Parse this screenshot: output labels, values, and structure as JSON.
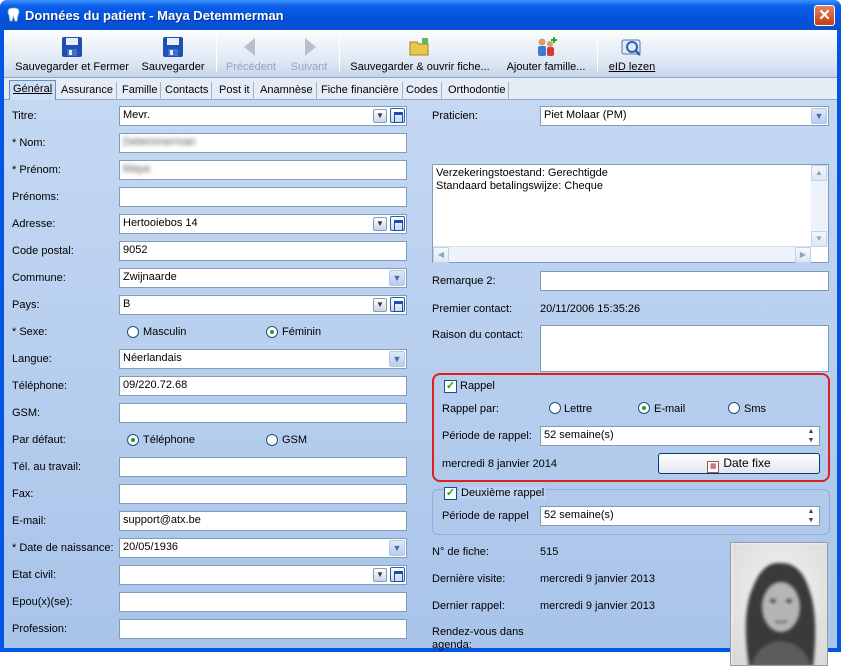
{
  "window": {
    "title": "Données du patient - Maya Detemmerman",
    "close": "✕"
  },
  "toolbar": {
    "save_close": "Sauvegarder et Fermer",
    "save": "Sauvegarder",
    "prev": "Précédent",
    "next": "Suivant",
    "save_open": "Sauvegarder & ouvrir fiche...",
    "add_family": "Ajouter famille...",
    "eid": "eID lezen"
  },
  "tabs": [
    "Général",
    "Assurance",
    "Famille",
    "Contacts",
    "Post it",
    "Anamnèse",
    "Fiche financière",
    "Codes",
    "Orthodontie"
  ],
  "left": {
    "titre": {
      "label": "Titre:",
      "value": "Mevr."
    },
    "nom": {
      "label": "* Nom:",
      "value": "Detemmerman"
    },
    "prenom": {
      "label": "* Prénom:",
      "value": "Maya"
    },
    "prenoms": {
      "label": "Prénoms:",
      "value": ""
    },
    "adresse": {
      "label": "Adresse:",
      "value": "Hertooiebos 14"
    },
    "code_postal": {
      "label": "Code postal:",
      "value": "9052"
    },
    "commune": {
      "label": "Commune:",
      "value": "Zwijnaarde"
    },
    "pays": {
      "label": "Pays:",
      "value": "B"
    },
    "sexe": {
      "label": "* Sexe:",
      "opt1": "Masculin",
      "opt2": "Féminin",
      "selected": "Féminin"
    },
    "langue": {
      "label": "Langue:",
      "value": "Néerlandais"
    },
    "telephone": {
      "label": "Téléphone:",
      "value": "09/220.72.68"
    },
    "gsm": {
      "label": "GSM:",
      "value": ""
    },
    "par_defaut": {
      "label": "Par défaut:",
      "opt1": "Téléphone",
      "opt2": "GSM",
      "selected": "Téléphone"
    },
    "tel_travail": {
      "label": "Tél. au travail:",
      "value": ""
    },
    "fax": {
      "label": "Fax:",
      "value": ""
    },
    "email": {
      "label": "E-mail:",
      "value": "support@atx.be"
    },
    "naissance": {
      "label": "* Date de naissance:",
      "value": "20/05/1936"
    },
    "etat_civil": {
      "label": "Etat civil:",
      "value": ""
    },
    "epoux": {
      "label": "Epou(x)(se):",
      "value": ""
    },
    "profession": {
      "label": "Profession:",
      "value": ""
    }
  },
  "right": {
    "praticien": {
      "label": "Praticien:",
      "value": "Piet Molaar (PM)"
    },
    "memo_lines": [
      "Verzekeringstoestand: Gerechtigde",
      "Standaard betalingswijze: Cheque"
    ],
    "remarque2": {
      "label": "Remarque 2:",
      "value": ""
    },
    "premier_contact": {
      "label": "Premier contact:",
      "value": "20/11/2006 15:35:26"
    },
    "raison": {
      "label": "Raison du contact:",
      "value": ""
    },
    "rappel": {
      "label": "Rappel",
      "checked": true,
      "par_label": "Rappel par:",
      "opt1": "Lettre",
      "opt2": "E-mail",
      "opt3": "Sms",
      "selected": "E-mail",
      "periode_label": "Période de rappel:",
      "periode_value": "52 semaine(s)",
      "date_text": "mercredi 8 janvier 2014",
      "date_button": "Date fixe"
    },
    "rappel2": {
      "label": "Deuxième rappel",
      "checked": true,
      "periode_label": "Période de rappel",
      "periode_value": "52 semaine(s)"
    },
    "fiche": {
      "label": "N° de fiche:",
      "value": "515"
    },
    "derniere_visite": {
      "label": "Dernière visite:",
      "value": "mercredi 9 janvier 2013"
    },
    "dernier_rappel": {
      "label": "Dernier rappel:",
      "value": "mercredi 9 janvier 2013"
    },
    "rdv": {
      "label1": "Rendez-vous dans",
      "label2": "agenda:"
    }
  },
  "colors": {
    "titlebar": "#0253de",
    "panel": "#b3cbeb",
    "highlight_border": "#e01f1f"
  }
}
